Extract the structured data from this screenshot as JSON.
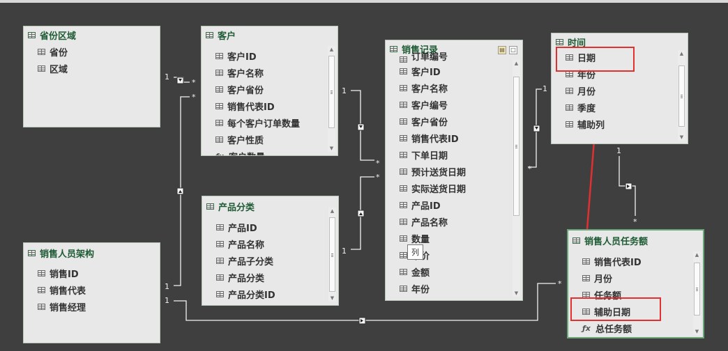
{
  "tables": {
    "province_region": {
      "title": "省份区域",
      "fields": [
        "省份",
        "区域"
      ]
    },
    "customer": {
      "title": "客户",
      "fields": [
        "客户ID",
        "客户名称",
        "客户省份",
        "销售代表ID",
        "每个客户订单数量",
        "客户性质",
        "客户数量"
      ]
    },
    "product_category": {
      "title": "产品分类",
      "fields": [
        "产品ID",
        "产品名称",
        "产品子分类",
        "产品分类",
        "产品分类ID"
      ]
    },
    "sales_org": {
      "title": "销售人员架构",
      "fields": [
        "销售ID",
        "销售代表",
        "销售经理"
      ]
    },
    "sales_record": {
      "title": "销售记录",
      "fields": [
        "订单编号",
        "客户ID",
        "客户名称",
        "客户编号",
        "客户省份",
        "销售代表ID",
        "下单日期",
        "预计送货日期",
        "实际送货日期",
        "产品ID",
        "产品名称",
        "数量",
        "单价",
        "金额",
        "年份"
      ]
    },
    "time": {
      "title": "时间",
      "fields": [
        "日期",
        "年份",
        "月份",
        "季度",
        "辅助列"
      ]
    },
    "sales_target": {
      "title": "销售人员任务额",
      "fields": [
        "销售代表ID",
        "月份",
        "任务额",
        "辅助日期"
      ],
      "measure": "总任务额"
    }
  },
  "tooltip": "列",
  "cardinality": {
    "one": "1",
    "many": "*"
  },
  "colors": {
    "background": "#3f3f3f",
    "card": "#e8e8e8",
    "title": "#1e5b34",
    "highlight": "#e03030",
    "line": "#f5f5f5"
  },
  "icons": {
    "table": "table-grid-icon",
    "column": "column-grid-icon",
    "measure": "fx-measure-icon",
    "filter": "filter-direction-icon"
  }
}
